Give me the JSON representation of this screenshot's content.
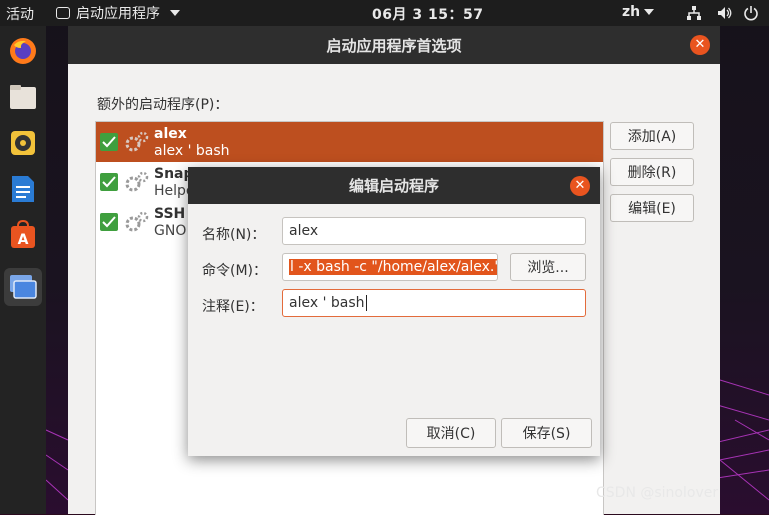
{
  "topbar": {
    "activities": "活动",
    "app_menu": "启动应用程序",
    "clock": "06月 3  15：57",
    "language": "zh"
  },
  "dock": {
    "items": [
      {
        "icon": "firefox-icon"
      },
      {
        "icon": "files-icon"
      },
      {
        "icon": "rhythmbox-icon"
      },
      {
        "icon": "writer-icon"
      },
      {
        "icon": "software-center-icon"
      },
      {
        "icon": "startup-apps-icon"
      }
    ]
  },
  "main_window": {
    "title": "启动应用程序首选项",
    "extra_programs_label": "额外的启动程序(P)：",
    "programs": [
      {
        "name": "alex",
        "description": "alex ' bash",
        "checked": true,
        "selected": true
      },
      {
        "name": "Snap",
        "description": "Helpe",
        "checked": true,
        "selected": false
      },
      {
        "name": "SSH",
        "description": "GNO",
        "checked": true,
        "selected": false
      }
    ],
    "buttons": {
      "add": "添加(A)",
      "remove": "删除(R)",
      "edit": "编辑(E)"
    }
  },
  "edit_dialog": {
    "title": "编辑启动程序",
    "name_label": "名称(N)：",
    "name_value": "alex",
    "command_label": "命令(M)：",
    "command_value": "l -x bash -c \"/home/alex/alex.\"",
    "browse_button": "浏览...",
    "comment_label": "注释(E)：",
    "comment_value": "alex ' bash",
    "cancel_button": "取消(C)",
    "save_button": "保存(S)"
  },
  "watermark": "CSDN @sinolover",
  "colors": {
    "accent": "#e9541f",
    "selection": "#bd4f1f",
    "checkbox": "#3f9f3e",
    "titlebar": "#2e2e2e"
  }
}
